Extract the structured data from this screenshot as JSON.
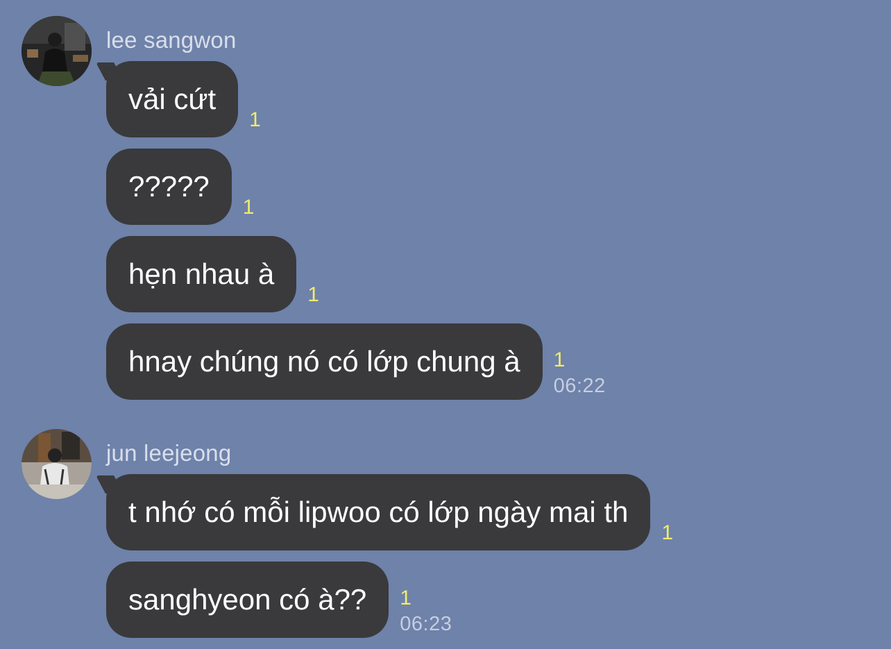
{
  "conversation": {
    "groups": [
      {
        "sender": "lee sangwon",
        "messages": [
          {
            "text": "vải cứt",
            "unread": "1"
          },
          {
            "text": "?????",
            "unread": "1"
          },
          {
            "text": "hẹn nhau à",
            "unread": "1"
          },
          {
            "text": "hnay chúng nó có lớp chung à",
            "unread": "1",
            "time": "06:22"
          }
        ]
      },
      {
        "sender": "jun leejeong",
        "messages": [
          {
            "text": "t nhớ có mỗi lipwoo có lớp ngày mai th",
            "unread": "1"
          },
          {
            "text": "sanghyeon có à??",
            "unread": "1",
            "time": "06:23"
          }
        ]
      }
    ]
  },
  "colors": {
    "background": "#6e82aa",
    "bubble": "#3a3a3c",
    "unread": "#f2eb6a",
    "time": "#c6cedf",
    "sender": "#d9deea"
  }
}
